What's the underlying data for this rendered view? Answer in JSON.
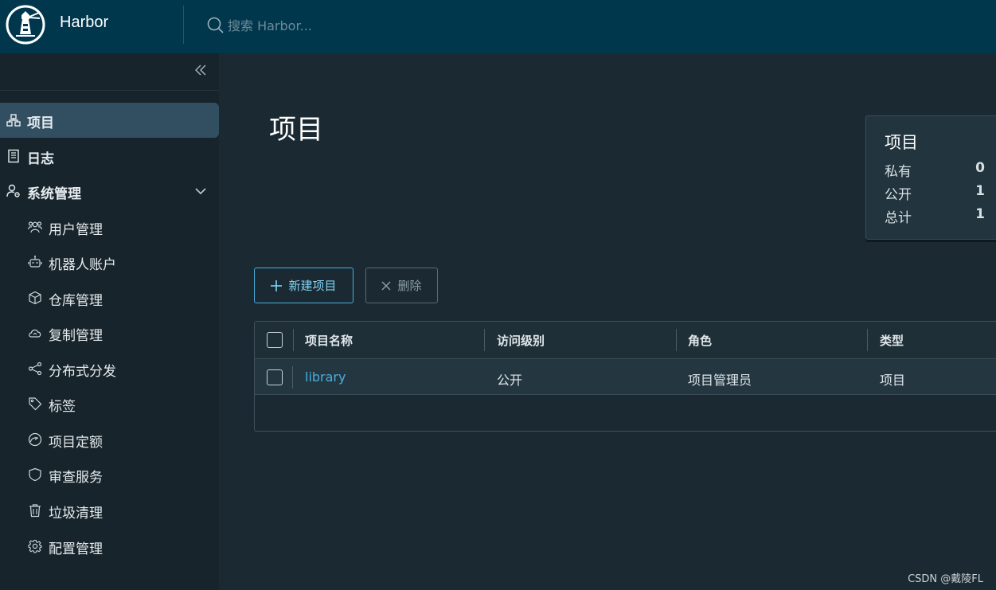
{
  "header": {
    "app_title": "Harbor",
    "search_placeholder": "搜索 Harbor..."
  },
  "sidebar": {
    "items": [
      {
        "label": "项目",
        "icon": "project-icon"
      },
      {
        "label": "日志",
        "icon": "log-icon"
      },
      {
        "label": "系统管理",
        "icon": "admin-user-gear-icon"
      },
      {
        "label": "用户管理",
        "icon": "users-icon"
      },
      {
        "label": "机器人账户",
        "icon": "robot-icon"
      },
      {
        "label": "仓库管理",
        "icon": "box-icon"
      },
      {
        "label": "复制管理",
        "icon": "cloud-sync-icon"
      },
      {
        "label": "分布式分发",
        "icon": "share-icon"
      },
      {
        "label": "标签",
        "icon": "tag-icon"
      },
      {
        "label": "项目定额",
        "icon": "gauge-icon"
      },
      {
        "label": "审查服务",
        "icon": "shield-icon"
      },
      {
        "label": "垃圾清理",
        "icon": "trash-icon"
      },
      {
        "label": "配置管理",
        "icon": "gear-icon"
      }
    ]
  },
  "main": {
    "page_title": "项目",
    "summary": {
      "title": "项目",
      "rows": [
        {
          "label": "私有",
          "value": "0"
        },
        {
          "label": "公开",
          "value": "1"
        },
        {
          "label": "总计",
          "value": "1"
        }
      ]
    },
    "actions": {
      "new_label": "新建项目",
      "delete_label": "删除"
    },
    "table": {
      "columns": [
        "项目名称",
        "访问级别",
        "角色",
        "类型"
      ],
      "rows": [
        {
          "name": "library",
          "access": "公开",
          "role": "项目管理员",
          "type": "项目"
        }
      ]
    }
  },
  "watermark": "CSDN @戴陵FL",
  "colors": {
    "header_bg": "#00374d",
    "sidebar_bg": "#17242b",
    "main_bg": "#1b2a32",
    "accent": "#49aee0",
    "active_item_bg": "#324f61"
  }
}
